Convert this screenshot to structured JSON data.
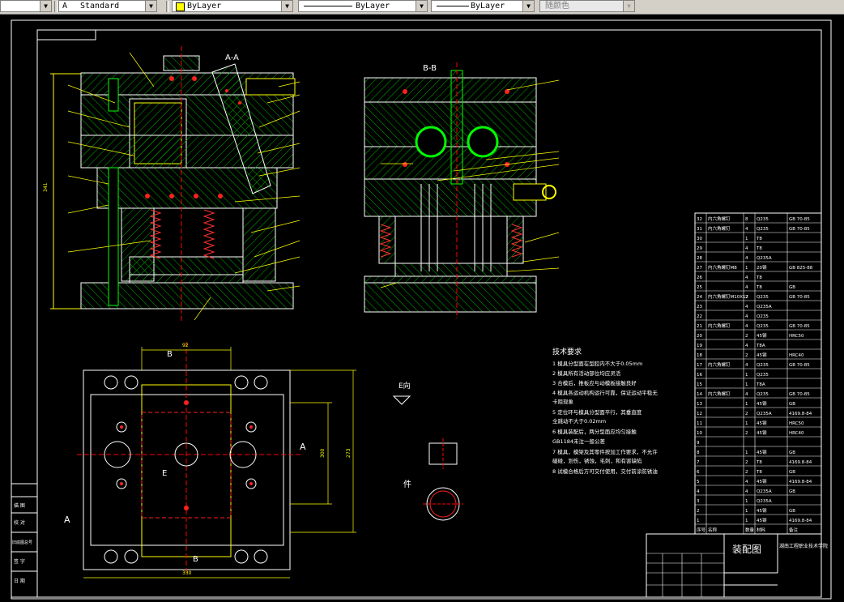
{
  "toolbar": {
    "text_style": "Standard",
    "layer_color": "ByLayer",
    "linetype": "ByLayer",
    "lineweight": "ByLayer",
    "plot_style": "随颜色",
    "layer_swatch_color": "#ffff00"
  },
  "drawing": {
    "section_aa": "A-A",
    "section_bb": "B-B",
    "view_e": "E向",
    "part_label": "件",
    "view_a": "A",
    "view_b": "B",
    "label_e": "E",
    "dim_top": "92",
    "dim_bottom": "330",
    "dim_left": "341",
    "dim_right1": "300",
    "dim_right2": "273",
    "tech_title": "技术要求",
    "tech_notes": [
      "1 模具分型面在型腔内不大于0.05mm",
      "2 模具所有活动部位均应灵活",
      "3 合模后，推板应与动模板接触良好",
      "4 模具各运动机构运行可靠，保证运动平稳无",
      "  卡阻现象",
      "5 定位环与模具分型面平行，其垂直度",
      "  全跳动不大于0.02mm",
      "6  模具装配后，两分型面应均匀接触",
      "GB1184未注一般公差",
      "7 模具，模架及其零件按加工作要求，不允许",
      "  磕碰，划伤，锈蚀，毛刺，和有害缺陷",
      "8 试模合格后方可交付使用，交付前涂防锈油"
    ],
    "bom_rows": [
      [
        "32",
        "内六角螺钉",
        "8",
        "Q235",
        "GB 70-85"
      ],
      [
        "31",
        "内六角螺钉",
        "4",
        "Q235",
        "GB 70-85"
      ],
      [
        "30",
        "",
        "1",
        "T8",
        ""
      ],
      [
        "29",
        "",
        "4",
        "T8",
        ""
      ],
      [
        "28",
        "",
        "4",
        "Q235A",
        ""
      ],
      [
        "27",
        "内六角螺钉M8",
        "1",
        "20钢",
        "GB 825-88"
      ],
      [
        "26",
        "",
        "4",
        "T8",
        ""
      ],
      [
        "25",
        "",
        "4",
        "T8",
        "GB"
      ],
      [
        "24",
        "内六角螺钉M10X12",
        "2",
        "Q235",
        "GB 70-85"
      ],
      [
        "23",
        "",
        "4",
        "Q235A",
        ""
      ],
      [
        "22",
        "",
        "4",
        "Q235",
        ""
      ],
      [
        "21",
        "内六角螺钉",
        "4",
        "Q235",
        "GB 70-85"
      ],
      [
        "20",
        "",
        "2",
        "45钢",
        "HRC50"
      ],
      [
        "19",
        "",
        "4",
        "T8A",
        ""
      ],
      [
        "18",
        "",
        "2",
        "45钢",
        "HRC40"
      ],
      [
        "17",
        "内六角螺钉",
        "4",
        "Q235",
        "GB 70-85"
      ],
      [
        "16",
        "",
        "1",
        "Q235",
        ""
      ],
      [
        "15",
        "",
        "1",
        "T8A",
        ""
      ],
      [
        "14",
        "内六角螺钉",
        "4",
        "Q235",
        "GB 70-85"
      ],
      [
        "13",
        "",
        "1",
        "45钢",
        "GB"
      ],
      [
        "12",
        "",
        "2",
        "Q235A",
        "4169.8-84"
      ],
      [
        "11",
        "",
        "1",
        "45钢",
        "HRC50"
      ],
      [
        "10",
        "",
        "2",
        "45钢",
        "HRC40"
      ],
      [
        "9",
        "",
        "",
        "",
        ""
      ],
      [
        "8",
        "",
        "1",
        "45钢",
        "GB"
      ],
      [
        "7",
        "",
        "2",
        "T8",
        "4169.8-84"
      ],
      [
        "6",
        "",
        "2",
        "T8",
        "GB"
      ],
      [
        "5",
        "",
        "4",
        "45钢",
        "4169.8-84"
      ],
      [
        "4",
        "",
        "4",
        "Q235A",
        "GB"
      ],
      [
        "3",
        "",
        "1",
        "Q235A",
        ""
      ],
      [
        "2",
        "",
        "1",
        "45钢",
        "GB"
      ],
      [
        "1",
        "",
        "1",
        "45钢",
        "4169.8-84"
      ]
    ],
    "bom_header": [
      "序号",
      "名称",
      "数量",
      "材料",
      "备注"
    ],
    "title_block_name": "装配图",
    "title_block_school": "湖南工程职业技术学院",
    "left_strip": [
      "描 图",
      "校 对",
      "旧底图总号",
      "签 字",
      "日 期"
    ]
  }
}
